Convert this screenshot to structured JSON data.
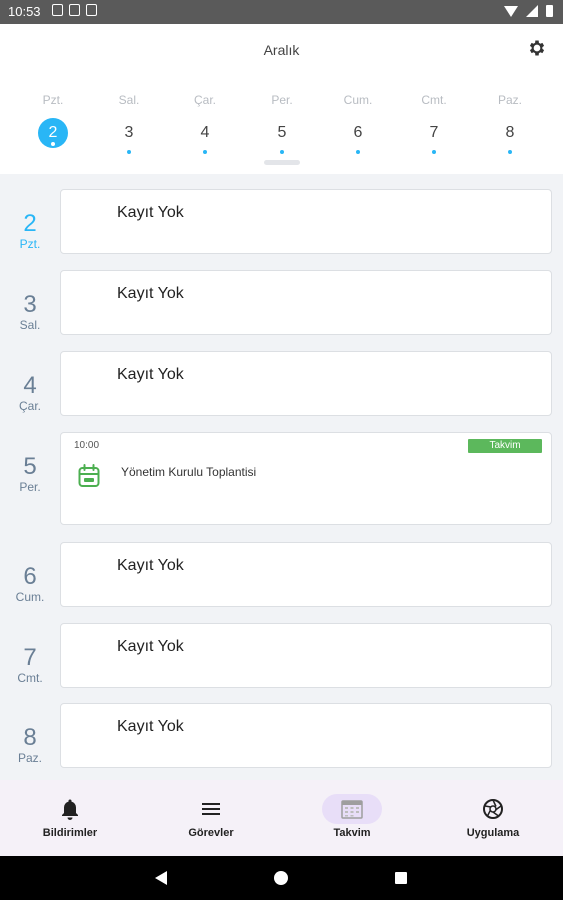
{
  "status_bar": {
    "time": "10:53"
  },
  "header": {
    "month": "Aralık"
  },
  "week": [
    {
      "name": "Pzt.",
      "num": "2",
      "selected": true
    },
    {
      "name": "Sal.",
      "num": "3"
    },
    {
      "name": "Çar.",
      "num": "4"
    },
    {
      "name": "Per.",
      "num": "5"
    },
    {
      "name": "Cum.",
      "num": "6"
    },
    {
      "name": "Cmt.",
      "num": "7"
    },
    {
      "name": "Paz.",
      "num": "8"
    }
  ],
  "days": [
    {
      "num": "2",
      "name": "Pzt.",
      "today": true,
      "empty_text": "Kayıt Yok"
    },
    {
      "num": "3",
      "name": "Sal.",
      "empty_text": "Kayıt Yok"
    },
    {
      "num": "4",
      "name": "Çar.",
      "empty_text": "Kayıt Yok"
    },
    {
      "num": "5",
      "name": "Per.",
      "event": {
        "time": "10:00",
        "badge": "Takvim",
        "title": "Yönetim Kurulu Toplantisi"
      }
    },
    {
      "num": "6",
      "name": "Cum.",
      "empty_text": "Kayıt Yok"
    },
    {
      "num": "7",
      "name": "Cmt.",
      "empty_text": "Kayıt Yok"
    },
    {
      "num": "8",
      "name": "Paz.",
      "empty_text": "Kayıt Yok"
    }
  ],
  "bottom_nav": [
    {
      "label": "Bildirimler",
      "icon": "bell-icon"
    },
    {
      "label": "Görevler",
      "icon": "menu-icon"
    },
    {
      "label": "Takvim",
      "icon": "calendar-icon",
      "active": true
    },
    {
      "label": "Uygulama",
      "icon": "aperture-icon"
    }
  ],
  "colors": {
    "accent": "#29b6f6",
    "badge": "#5cb85c",
    "event_icon": "#4caf50",
    "nav_bg": "#f5f1f8",
    "nav_active": "#e8def8"
  }
}
